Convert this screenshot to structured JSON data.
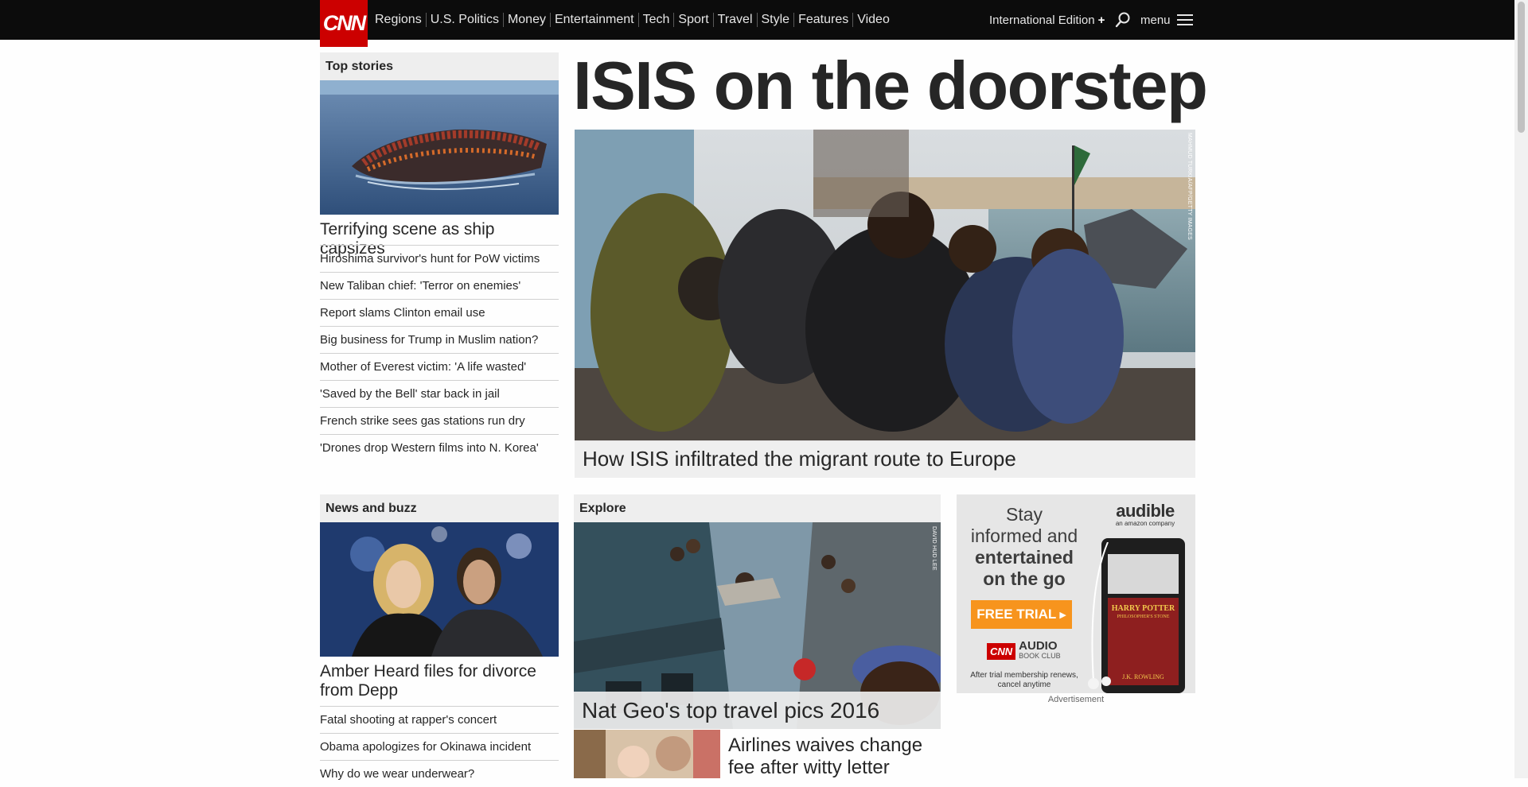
{
  "nav": {
    "logo": "CNN",
    "links": [
      "Regions",
      "U.S. Politics",
      "Money",
      "Entertainment",
      "Tech",
      "Sport",
      "Travel",
      "Style",
      "Features",
      "Video"
    ],
    "edition": "International Edition",
    "edition_plus": "+",
    "menu_label": "menu"
  },
  "hero": {
    "title": "ISIS on the doorstep",
    "caption": "How ISIS infiltrated the migrant route to Europe",
    "credit": "MAHMUD TURKIA/AFP/GETTY IMAGES"
  },
  "top_stories": {
    "header": "Top stories",
    "lead": "Terrifying scene as ship capsizes",
    "items": [
      "Hiroshima survivor's hunt for PoW victims",
      "New Taliban chief: 'Terror on enemies'",
      "Report slams Clinton email use",
      "Big business for Trump in Muslim nation?",
      "Mother of Everest victim: 'A life wasted'",
      "'Saved by the Bell' star back in jail",
      "French strike sees gas stations run dry",
      "'Drones drop Western films into N. Korea'"
    ]
  },
  "news_buzz": {
    "header": "News and buzz",
    "lead": "Amber Heard files for divorce from Depp",
    "items": [
      "Fatal shooting at rapper's concert",
      "Obama apologizes for Okinawa incident",
      "Why do we wear underwear?"
    ]
  },
  "explore": {
    "header": "Explore",
    "lead_caption": "Nat Geo's top travel pics 2016",
    "credit": "DAVID HUD LEE",
    "second": "Airlines waives change fee after witty letter"
  },
  "ad": {
    "brand": "audible",
    "brand_sub": "an amazon company",
    "line1": "Stay",
    "line2": "informed and",
    "line3": "entertained",
    "line4": "on the go",
    "cta": "FREE TRIAL",
    "club_logo": "CNN",
    "club_name": "AUDIO",
    "club_sub": "BOOK CLUB",
    "fine_print": "After trial membership renews, cancel anytime",
    "book_title": "HARRY POTTER",
    "book_sub": "PHILOSOPHER'S STONE",
    "book_author": "J.K. ROWLING",
    "label": "Advertisement"
  },
  "colors": {
    "brand_red": "#cc0000",
    "nav_bg": "#0c0c0c",
    "cta_orange": "#f7941d"
  }
}
